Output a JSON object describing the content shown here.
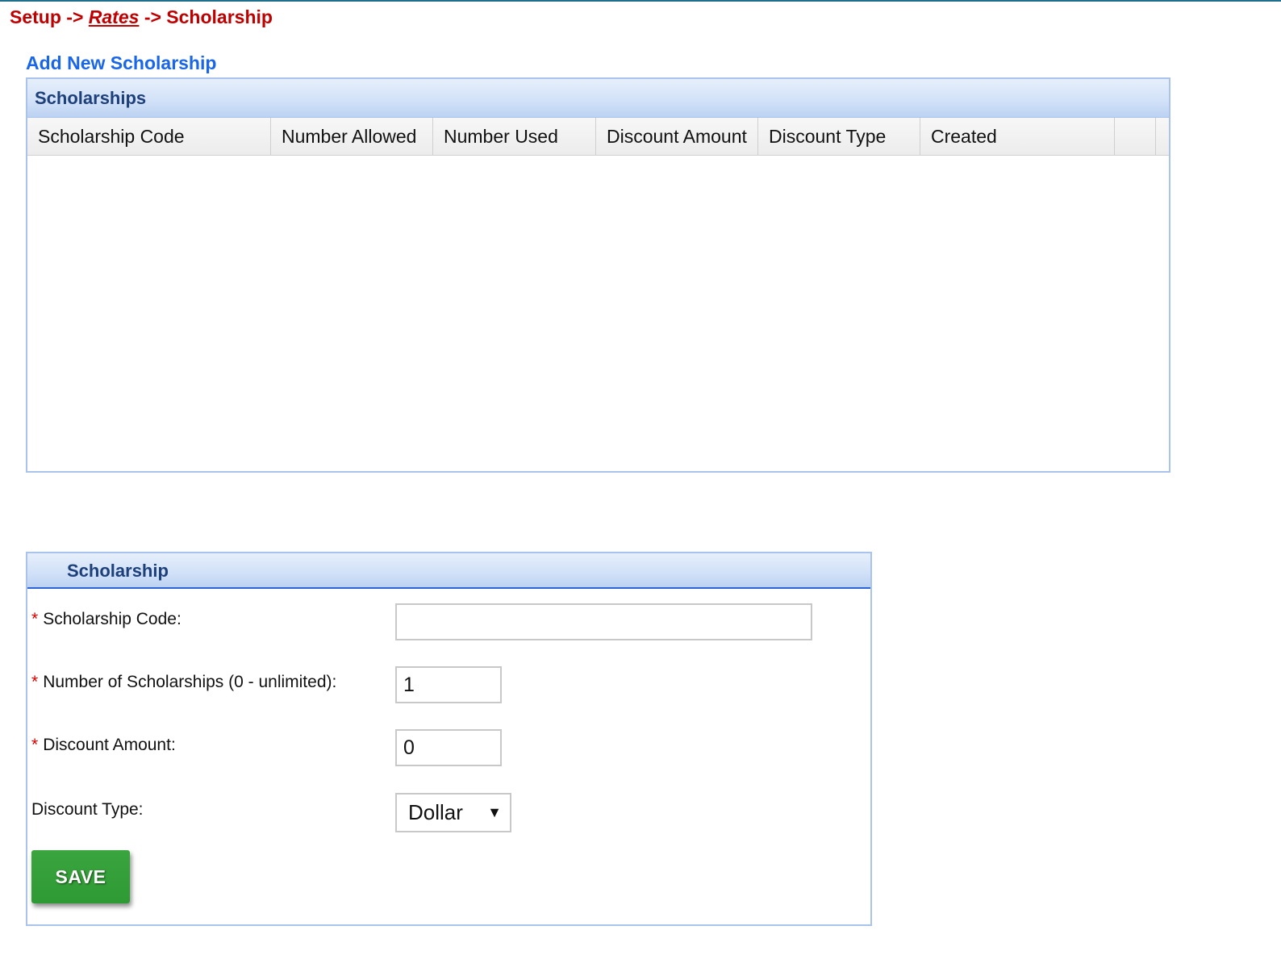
{
  "breadcrumb": {
    "setup": "Setup",
    "sep1": "->",
    "rates": "Rates",
    "sep2": "->",
    "current": "Scholarship"
  },
  "add_link": "Add New Scholarship",
  "grid": {
    "title": "Scholarships",
    "columns": [
      "Scholarship Code",
      "Number Allowed",
      "Number Used",
      "Discount Amount",
      "Discount Type",
      "Created",
      ""
    ],
    "rows": []
  },
  "form": {
    "title": "Scholarship",
    "required_marker": "*",
    "code_label": "Scholarship Code:",
    "code_value": "",
    "number_label": "Number of Scholarships (0 - unlimited):",
    "number_value": "1",
    "amount_label": "Discount Amount:",
    "amount_value": "0",
    "type_label": "Discount Type:",
    "type_selected": "Dollar",
    "save_label": "SAVE"
  },
  "colors": {
    "breadcrumb": "#c00000",
    "link": "#1a66e8",
    "panel_title": "#1d3f7a",
    "panel_border": "#a9c3ec",
    "form_border": "#2a64d8",
    "save_button": "#2e9a33",
    "required": "#d40000"
  },
  "icons": {
    "select_arrow": "dropdown-triangle-icon"
  }
}
